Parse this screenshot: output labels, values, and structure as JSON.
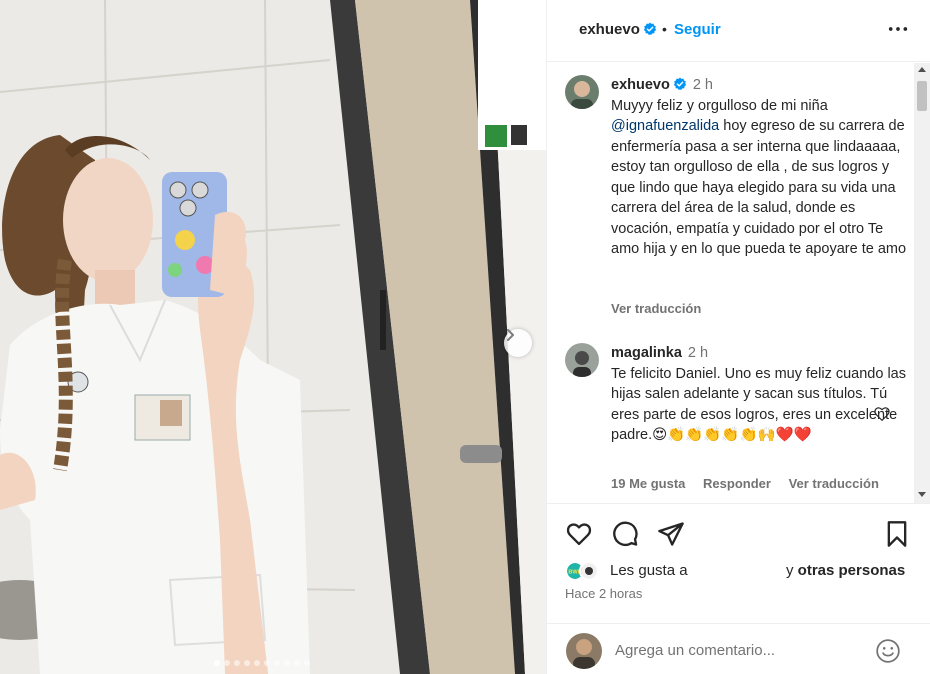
{
  "post": {
    "username": "exhuevo",
    "separator": "•",
    "follow_label": "Seguir",
    "more_icon": "more-horizontal-icon"
  },
  "caption": {
    "username": "exhuevo",
    "time": "2 h",
    "text_before": "Muyyy feliz y orgulloso de mi niña",
    "mention": "@ignafuenzalida",
    "text_after": "hoy egreso de su carrera de enfermería pasa a ser interna que lindaaaaa, estoy tan orgulloso de ella , de sus logros y que lindo que haya elegido para su vida una carrera del área de la salud, donde es vocación, empatía y cuidado por el otro Te amo hija y en lo que pueda te apoyare te amo",
    "translate_label": "Ver traducción"
  },
  "comment": {
    "username": "magalinka",
    "time": "2 h",
    "text": "Te felicito Daniel. Uno es muy feliz cuando las hijas salen adelante y sacan sus títulos. Tú eres parte de esos logros, eres un excelente padre.",
    "emojis": "😍👏👏👏👏👏🙌❤️❤️",
    "likes_label": "19 Me gusta",
    "reply_label": "Responder",
    "translate_label": "Ver traducción"
  },
  "actions": {
    "likes_prefix": "Les gusta a",
    "likes_and": "y",
    "likes_others": "otras personas",
    "time_ago": "Hace 2 horas"
  },
  "add_comment": {
    "placeholder": "Agrega un comentario..."
  },
  "carousel": {
    "total_slides": 10,
    "current_index": 0
  },
  "colors": {
    "link_blue": "#0095f6",
    "verified_blue": "#0095f6",
    "text_primary": "#262626",
    "text_secondary": "#737373"
  }
}
